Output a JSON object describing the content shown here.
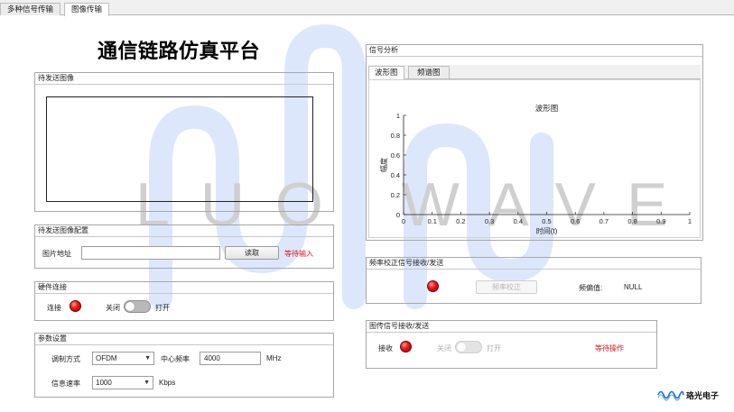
{
  "tabs": [
    {
      "label": "多种信号传输",
      "active": false
    },
    {
      "label": "图像传输",
      "active": true
    }
  ],
  "app_title": "通信链路仿真平台",
  "watermark": "LUO WAVE",
  "image_panel": {
    "title": "待发送图像"
  },
  "config_panel": {
    "title": "待发送图像配置",
    "path_label": "图片地址",
    "path_value": "",
    "read_button": "读取",
    "status": "等待输入"
  },
  "hardware_panel": {
    "title": "硬件连接",
    "connect_label": "连接",
    "off_label": "关闭",
    "on_label": "打开"
  },
  "params_panel": {
    "title": "参数设置",
    "modulation_label": "调制方式",
    "modulation_value": "OFDM",
    "center_freq_label": "中心频率",
    "center_freq_value": "4000",
    "center_freq_unit": "MHz",
    "rate_label": "信息速率",
    "rate_value": "1000",
    "rate_unit": "Kbps"
  },
  "signal_panel": {
    "title": "信号分析",
    "tabs": [
      {
        "label": "波形图",
        "active": true
      },
      {
        "label": "频谱图",
        "active": false
      }
    ]
  },
  "chart_data": {
    "type": "line",
    "title": "波形图",
    "xlabel": "时间(t)",
    "ylabel": "幅度",
    "xlim": [
      0,
      1
    ],
    "ylim": [
      0,
      1
    ],
    "xticks": [
      "0",
      "0.1",
      "0.2",
      "0.3",
      "0.4",
      "0.5",
      "0.6",
      "0.7",
      "0.8",
      "0.9",
      "1"
    ],
    "yticks": [
      "0",
      "0.2",
      "0.4",
      "0.6",
      "0.8",
      "1"
    ],
    "series": [],
    "grid": false
  },
  "freq_panel": {
    "title": "频率校正信号接收/发送",
    "button": "频率校正",
    "offset_label": "频偏值:",
    "offset_value": "NULL"
  },
  "imgrx_panel": {
    "title": "图传信号接收/发送",
    "rx_label": "接收",
    "off_label": "关闭",
    "on_label": "打开",
    "status": "等待操作"
  },
  "logo": {
    "text": "珞光电子"
  }
}
